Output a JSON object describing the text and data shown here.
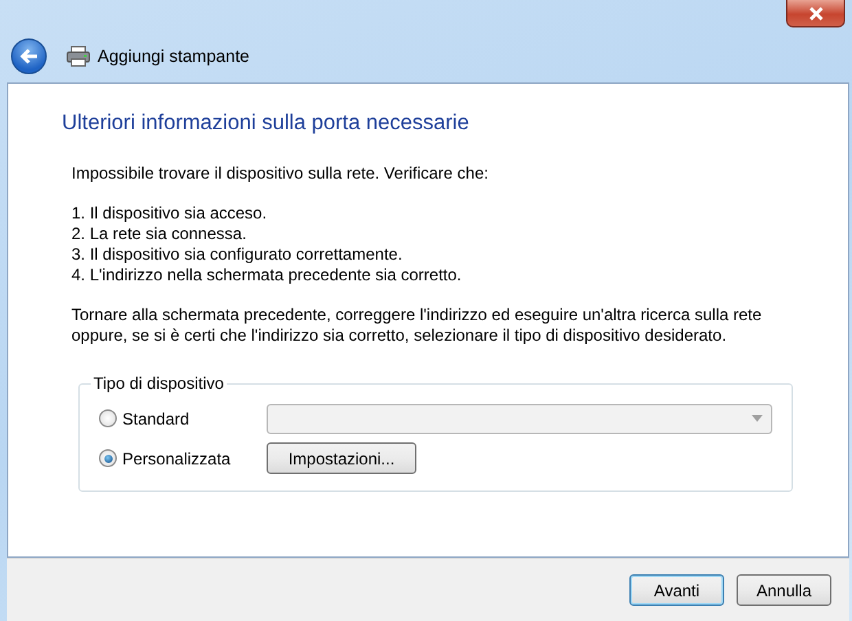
{
  "window": {
    "title": "Aggiungi stampante"
  },
  "heading": "Ulteriori informazioni sulla porta necessarie",
  "intro": "Impossibile trovare il dispositivo sulla rete. Verificare che:",
  "checklist": [
    "1. Il dispositivo sia acceso.",
    "2. La rete sia connessa.",
    "3. Il dispositivo sia configurato correttamente.",
    "4. L'indirizzo nella schermata precedente sia corretto."
  ],
  "instructions": "Tornare alla schermata precedente, correggere l'indirizzo ed eseguire un'altra ricerca sulla rete oppure, se si è certi che l'indirizzo sia corretto, selezionare il tipo di dispositivo desiderato.",
  "device_type": {
    "legend": "Tipo di dispositivo",
    "options": [
      {
        "label": "Standard",
        "selected": false,
        "kind": "dropdown",
        "disabled": true
      },
      {
        "label": "Personalizzata",
        "selected": true,
        "kind": "button",
        "button": "Impostazioni..."
      }
    ]
  },
  "buttons": [
    {
      "label": "Avanti",
      "default": true
    },
    {
      "label": "Annulla",
      "default": false
    }
  ]
}
